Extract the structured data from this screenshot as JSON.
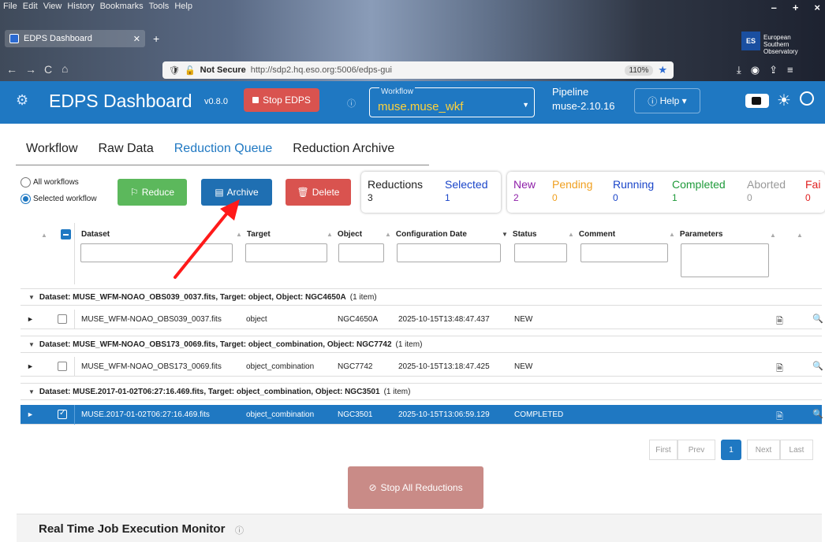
{
  "browser": {
    "menu": [
      "File",
      "Edit",
      "View",
      "History",
      "Bookmarks",
      "Tools",
      "Help"
    ],
    "tab_title": "EDPS Dashboard",
    "security": "Not Secure",
    "url": "http://sdp2.hq.eso.org:5006/edps-gui",
    "zoom": "110%",
    "eso_text": [
      "European",
      "Southern",
      "Observatory"
    ]
  },
  "header": {
    "title": "EDPS Dashboard",
    "version": "v0.8.0",
    "stop_label": "Stop EDPS",
    "workflow_label": "Workflow",
    "workflow_value": "muse.muse_wkf",
    "pipeline_label": "Pipeline",
    "pipeline_value": "muse-2.10.16",
    "help_label": "Help"
  },
  "tabs": [
    "Workflow",
    "Raw Data",
    "Reduction Queue",
    "Reduction Archive"
  ],
  "active_tab": "Reduction Queue",
  "filters": {
    "all_workflows": "All workflows",
    "selected_workflow": "Selected workflow",
    "selected": "selected_workflow"
  },
  "actions": {
    "reduce": "Reduce",
    "archive": "Archive",
    "delete": "Delete"
  },
  "summary": {
    "reductions_label": "Reductions",
    "reductions_value": "3",
    "selected_label": "Selected",
    "selected_value": "1"
  },
  "status_counts": {
    "new_label": "New",
    "new_value": "2",
    "pending_label": "Pending",
    "pending_value": "0",
    "running_label": "Running",
    "running_value": "0",
    "completed_label": "Completed",
    "completed_value": "1",
    "aborted_label": "Aborted",
    "aborted_value": "0",
    "failed_label": "Fai",
    "failed_value": "0"
  },
  "colors": {
    "new": "#8e1fa8",
    "pending": "#f0a020",
    "running": "#1a45c9",
    "completed": "#1e9a3a",
    "aborted": "#999999",
    "failed": "#e02020",
    "primary": "#1f78c2"
  },
  "table": {
    "columns": [
      "Dataset",
      "Target",
      "Object",
      "Configuration Date",
      "Status",
      "Comment",
      "Parameters"
    ],
    "groups": [
      {
        "header": "Dataset: MUSE_WFM-NOAO_OBS039_0037.fits, Target: object, Object: NGC4650A",
        "count": "(1 item)",
        "row": {
          "dataset": "MUSE_WFM-NOAO_OBS039_0037.fits",
          "target": "object",
          "object": "NGC4650A",
          "date": "2025-10-15T13:48:47.437",
          "status": "NEW"
        }
      },
      {
        "header": "Dataset: MUSE_WFM-NOAO_OBS173_0069.fits, Target: object_combination, Object: NGC7742",
        "count": "(1 item)",
        "row": {
          "dataset": "MUSE_WFM-NOAO_OBS173_0069.fits",
          "target": "object_combination",
          "object": "NGC7742",
          "date": "2025-10-15T13:18:47.425",
          "status": "NEW"
        }
      },
      {
        "header": "Dataset: MUSE.2017-01-02T06:27:16.469.fits, Target: object_combination, Object: NGC3501",
        "count": "(1 item)",
        "row": {
          "dataset": "MUSE.2017-01-02T06:27:16.469.fits",
          "target": "object_combination",
          "object": "NGC3501",
          "date": "2025-10-15T13:06:59.129",
          "status": "COMPLETED"
        }
      }
    ]
  },
  "pagination": {
    "first": "First",
    "prev": "Prev",
    "current": "1",
    "next": "Next",
    "last": "Last"
  },
  "stop_all": "Stop All Reductions",
  "monitor_title": "Real Time Job Execution Monitor",
  "icons": {
    "logo": "eso-logo-icon",
    "stop": "stop-square-icon",
    "help": "help-circle-icon",
    "reduce": "run-icon",
    "archive": "archive-icon",
    "delete": "trash-icon",
    "doc": "document-icon",
    "search": "search-icon"
  }
}
